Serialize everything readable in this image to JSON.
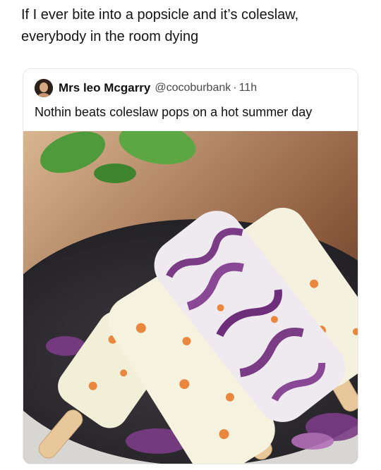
{
  "caption": {
    "line1": "If I ever bite into a popsicle and it’s coleslaw,",
    "line2": "everybody in the room dying"
  },
  "quoted_post": {
    "author_name": "Mrs leo Mcgarry",
    "author_handle": "@cocoburbank",
    "separator": "·",
    "timestamp": "11h",
    "text": "Nothin beats coleslaw pops on a hot summer day"
  },
  "photo": {
    "icon": "popsicle-photo",
    "colors": {
      "popsicle": "#f2efd9",
      "cabbage": "#7b3c86",
      "carrot": "#e9873e",
      "stick": "#e8c79a",
      "plate": "#2e2c30",
      "mint": "#4f9a3a"
    }
  }
}
